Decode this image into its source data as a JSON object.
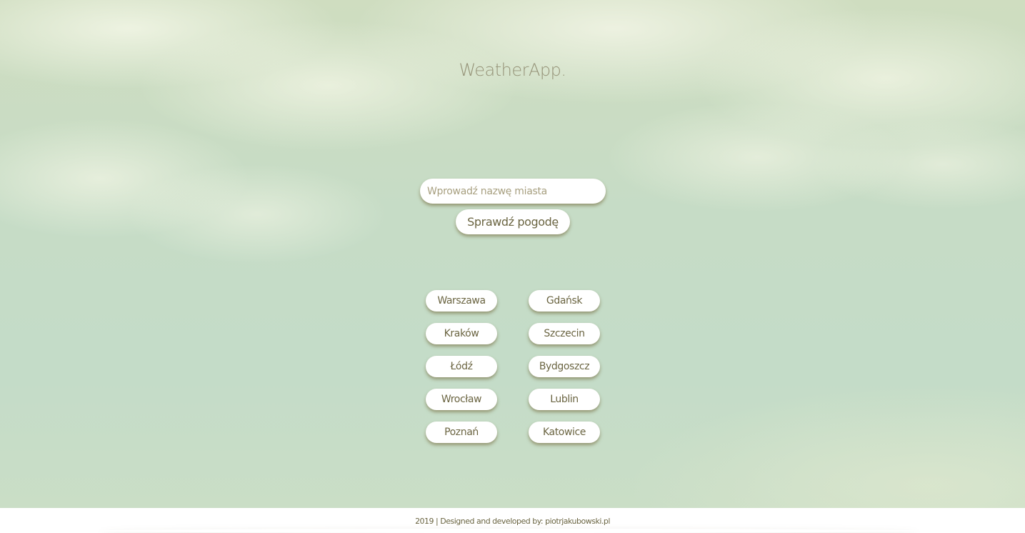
{
  "app": {
    "title": "WeatherApp."
  },
  "search": {
    "placeholder": "Wprowadź nazwę miasta",
    "value": "",
    "button_label": "Sprawdź pogodę"
  },
  "cities": {
    "left": [
      "Warszawa",
      "Kraków",
      "Łódź",
      "Wrocław",
      "Poznań"
    ],
    "right": [
      "Gdańsk",
      "Szczecin",
      "Bydgoszcz",
      "Lublin",
      "Katowice"
    ]
  },
  "footer": {
    "text": "2019 | Designed and developed by: piotrjakubowski.pl"
  },
  "colors": {
    "text": "#6b6542",
    "button_bg": "#ffffff",
    "background": "#c6dcc6"
  }
}
